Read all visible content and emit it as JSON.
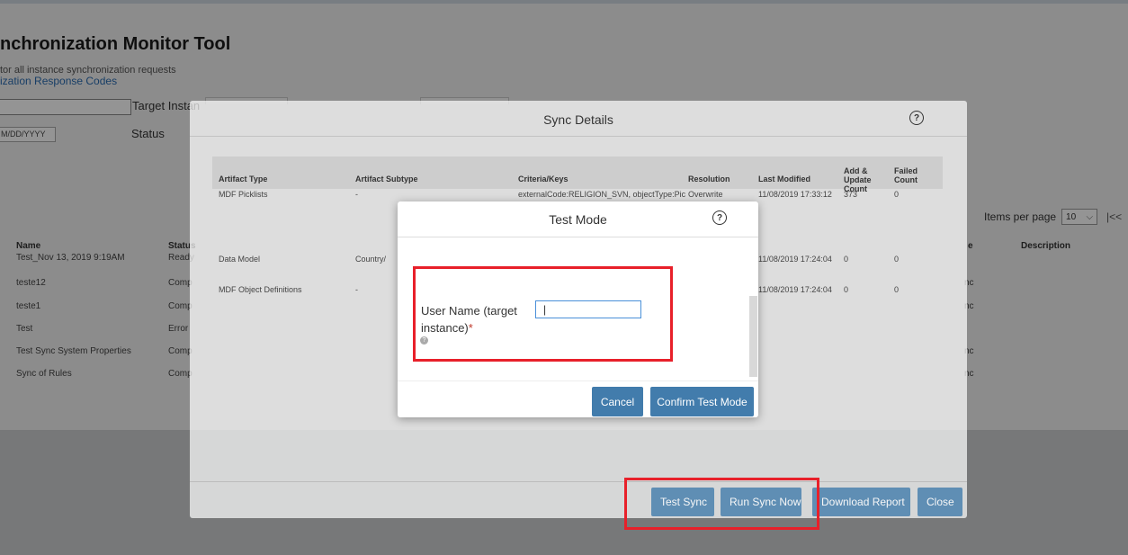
{
  "page": {
    "title": "nchronization Monitor Tool",
    "subtitle": "tor all instance synchronization requests",
    "response_codes_link": "ization Response Codes",
    "target_instance_label": "Target Instan",
    "date_placeholder": "M/DD/YYYY",
    "status_label": "Status",
    "items_per_page_label": "Items per page",
    "items_per_page_value": "10",
    "table_headers": [
      "Name",
      "Status",
      "e",
      "Description"
    ],
    "rows": [
      {
        "name": "Test_Nov 13, 2019 9:19AM",
        "status": "Ready",
        "right": ""
      },
      {
        "name": "teste12",
        "status": "Comp",
        "right": "nc"
      },
      {
        "name": "teste1",
        "status": "Comp",
        "right": "nc"
      },
      {
        "name": "Test",
        "status": "Error",
        "right": ""
      },
      {
        "name": "Test Sync System Properties",
        "status": "Comp",
        "right": "nc"
      },
      {
        "name": "Sync of Rules",
        "status": "Comp",
        "right": "nc"
      }
    ]
  },
  "sync_dialog": {
    "title": "Sync Details",
    "headers": {
      "artifact_type": "Artifact Type",
      "artifact_subtype": "Artifact Subtype",
      "criteria": "Criteria/Keys",
      "resolution": "Resolution",
      "last_modified": "Last Modified",
      "add_update_count": "Add & Update Count",
      "failed_count": "Failed Count"
    },
    "rows": [
      {
        "type": "MDF Picklists",
        "subtype": "-",
        "criteria": "externalCode:RELIGION_SVN, objectType:Pic",
        "resolution": "Overwrite",
        "modified": "11/08/2019 17:33:12",
        "add_update": "373",
        "failed": "0"
      },
      {
        "type": "Data Model",
        "subtype": "Country/",
        "criteria": "",
        "resolution": "",
        "modified": "11/08/2019 17:24:04",
        "add_update": "0",
        "failed": "0"
      },
      {
        "type": "MDF Object Definitions",
        "subtype": "-",
        "criteria": "",
        "resolution": "",
        "modified": "11/08/2019 17:24:04",
        "add_update": "0",
        "failed": "0"
      }
    ],
    "buttons": {
      "test_sync": "Test Sync",
      "run_sync_now": "Run Sync Now",
      "download_report": "Download Report",
      "close": "Close"
    }
  },
  "test_dialog": {
    "title": "Test Mode",
    "field_label": "User Name (target instance)",
    "required_mark": "*",
    "input_value": "|",
    "cancel_label": "Cancel",
    "confirm_label": "Confirm Test Mode"
  },
  "colors": {
    "primary_button": "#427cac",
    "annotation_red": "#e8202a",
    "link": "#2a6bb0"
  }
}
